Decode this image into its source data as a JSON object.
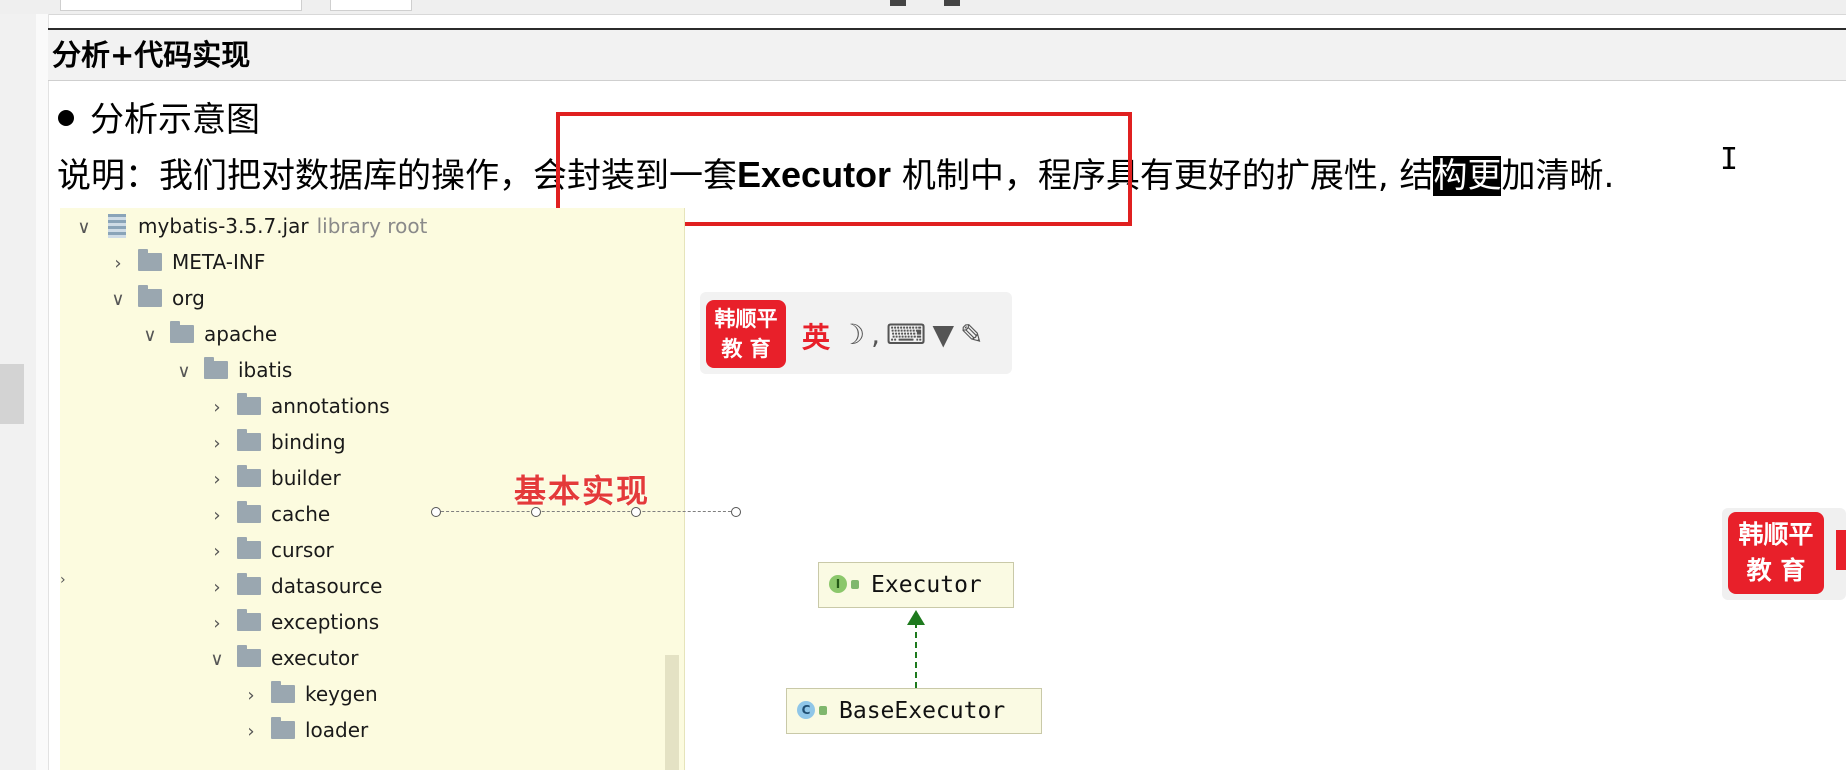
{
  "section": {
    "heading": "分析+代码实现"
  },
  "bullet": {
    "text": "分析示意图"
  },
  "description": {
    "before": "说明：我们把对数据库的操作，会封装到一套",
    "bold": "Executor",
    "middle": " 机制中，程序具有更好的扩展性, 结",
    "highlight": "构更",
    "after": "加清晰."
  },
  "tree": {
    "root": {
      "label": "mybatis-3.5.7.jar",
      "suffix": "library root"
    },
    "items": [
      {
        "label": "META-INF"
      },
      {
        "label": "org"
      },
      {
        "label": "apache"
      },
      {
        "label": "ibatis"
      },
      {
        "label": "annotations"
      },
      {
        "label": "binding"
      },
      {
        "label": "builder"
      },
      {
        "label": "cache"
      },
      {
        "label": "cursor"
      },
      {
        "label": "datasource"
      },
      {
        "label": "exceptions"
      },
      {
        "label": "executor"
      },
      {
        "label": "keygen"
      },
      {
        "label": "loader"
      }
    ]
  },
  "ime": {
    "logo_line1": "韩顺平",
    "logo_line2": "教 育",
    "lang": "英",
    "icons": [
      "moon-icon",
      "comma-icon",
      "keyboard-icon",
      "shirt-icon",
      "wrench-icon"
    ]
  },
  "canvas": {
    "label": "基本实现",
    "nodes": [
      {
        "name": "Executor",
        "kind": "I"
      },
      {
        "name": "BaseExecutor",
        "kind": "C"
      }
    ]
  },
  "colors": {
    "brand_red": "#e8202a",
    "highlight_box": "#e02020",
    "arrow_green": "#1e7a1e",
    "tree_bg": "#fcfbdf"
  }
}
